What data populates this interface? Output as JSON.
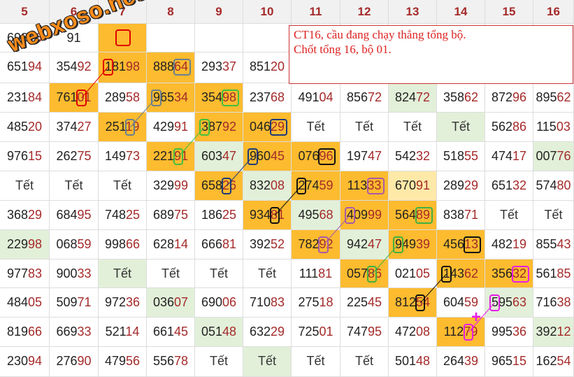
{
  "columns": [
    "5",
    "6",
    "7",
    "8",
    "9",
    "10",
    "11",
    "12",
    "13",
    "14",
    "15",
    "16"
  ],
  "rows": [
    [
      "69876",
      "91",
      "",
      "",
      "",
      "",
      "",
      "",
      "",
      "",
      "",
      ""
    ],
    [
      "65194",
      "35492",
      "18198",
      "88864",
      "29337",
      "85120",
      "",
      "",
      "",
      "",
      "",
      ""
    ],
    [
      "23184",
      "76101",
      "28958",
      "96534",
      "35498",
      "23768",
      "49104",
      "85672",
      "82472",
      "35862",
      "87296",
      "89562"
    ],
    [
      "48520",
      "37427",
      "25119",
      "42991",
      "38792",
      "04629",
      "Tết",
      "Tết",
      "Tết",
      "Tết",
      "56286",
      "11503"
    ],
    [
      "97615",
      "26275",
      "14973",
      "22191",
      "60347",
      "96045",
      "07696",
      "19747",
      "54232",
      "51855",
      "47417",
      "00776"
    ],
    [
      "Tết",
      "Tết",
      "Tết",
      "32999",
      "65826",
      "83208",
      "27459",
      "11333",
      "67091",
      "28929",
      "65132",
      "57480"
    ],
    [
      "36829",
      "68495",
      "74825",
      "68975",
      "18625",
      "93481",
      "49568",
      "40999",
      "56489",
      "83871",
      "Tết",
      "Tết"
    ],
    [
      "22998",
      "06859",
      "99866",
      "62814",
      "66681",
      "39252",
      "78292",
      "94247",
      "94939",
      "45613",
      "48219",
      "85543"
    ],
    [
      "97783",
      "90033",
      "Tết",
      "Tết",
      "Tết",
      "Tết",
      "11181",
      "05786",
      "02105",
      "14362",
      "35632",
      "56185"
    ],
    [
      "48405",
      "50971",
      "97236",
      "03607",
      "69006",
      "71083",
      "27518",
      "22545",
      "81254",
      "60459",
      "59563",
      "71638"
    ],
    [
      "81966",
      "66933",
      "52114",
      "66145",
      "05148",
      "63229",
      "72501",
      "74795",
      "47208",
      "11279",
      "99536",
      "39212"
    ],
    [
      "23094",
      "27690",
      "47956",
      "55678",
      "Tết",
      "Tết",
      "Tết",
      "Tết",
      "50148",
      "26439",
      "96515",
      "16254"
    ]
  ],
  "note": {
    "line1": "CT16, cầu đang chạy thẳng tổng bộ.",
    "line2": "Chốt tổng 16, bộ 01."
  },
  "watermark": "webxoso.net",
  "colors": {
    "green_cell": "#e2f0d9",
    "orange_cell": "#fdbb2f",
    "light_yellow_cell": "#ffe9a8",
    "header_text": "#a52a2a"
  }
}
